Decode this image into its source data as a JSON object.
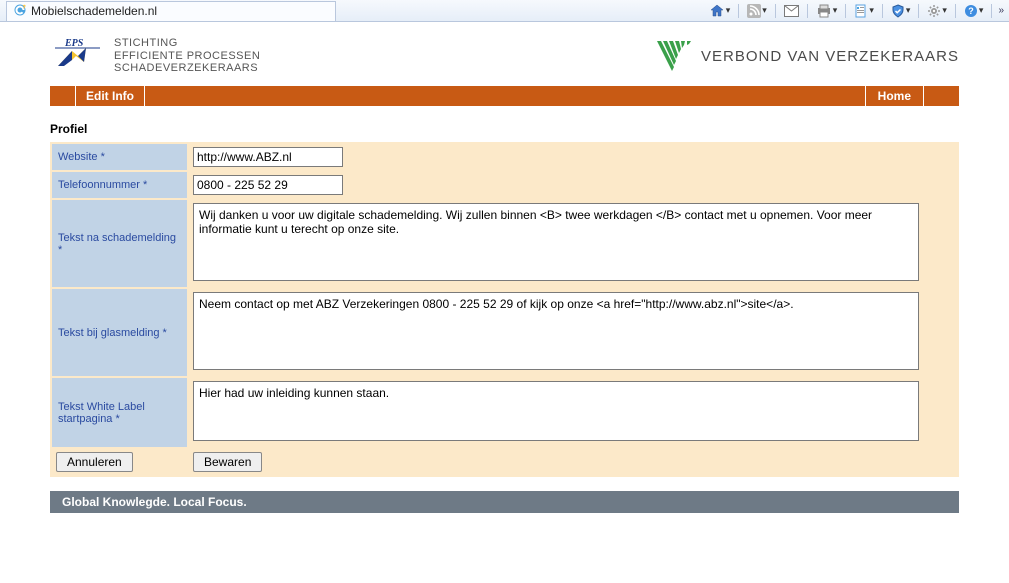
{
  "browser": {
    "title": "Mobielschademelden.nl"
  },
  "header": {
    "eps_title": "EPS",
    "eps_line1": "STICHTING",
    "eps_line2": "EFFICIENTE PROCESSEN",
    "eps_line3": "SCHADEVERZEKERAARS",
    "right_title": "VERBOND VAN VERZEKERAARS"
  },
  "nav": {
    "edit_info": "Edit Info",
    "home": "Home"
  },
  "section": {
    "title": "Profiel"
  },
  "form": {
    "website_label": "Website *",
    "website_value": "http://www.ABZ.nl",
    "phone_label": "Telefoonnummer *",
    "phone_value": "0800 - 225 52 29",
    "text1_label": "Tekst na schademelding *",
    "text1_value": "Wij danken u voor uw digitale schademelding. Wij zullen binnen <B> twee werkdagen </B> contact met u opnemen. Voor meer informatie kunt u terecht op onze site.",
    "text2_label": "Tekst bij glasmelding *",
    "text2_value": "Neem contact op met ABZ Verzekeringen 0800 - 225 52 29 of kijk op onze <a href=\"http://www.abz.nl\">site</a>.",
    "text3_label": "Tekst White Label startpagina *",
    "text3_value": "Hier had uw inleiding kunnen staan.",
    "cancel": "Annuleren",
    "save": "Bewaren"
  },
  "footer": {
    "text": "Global Knowlegde. Local Focus."
  }
}
